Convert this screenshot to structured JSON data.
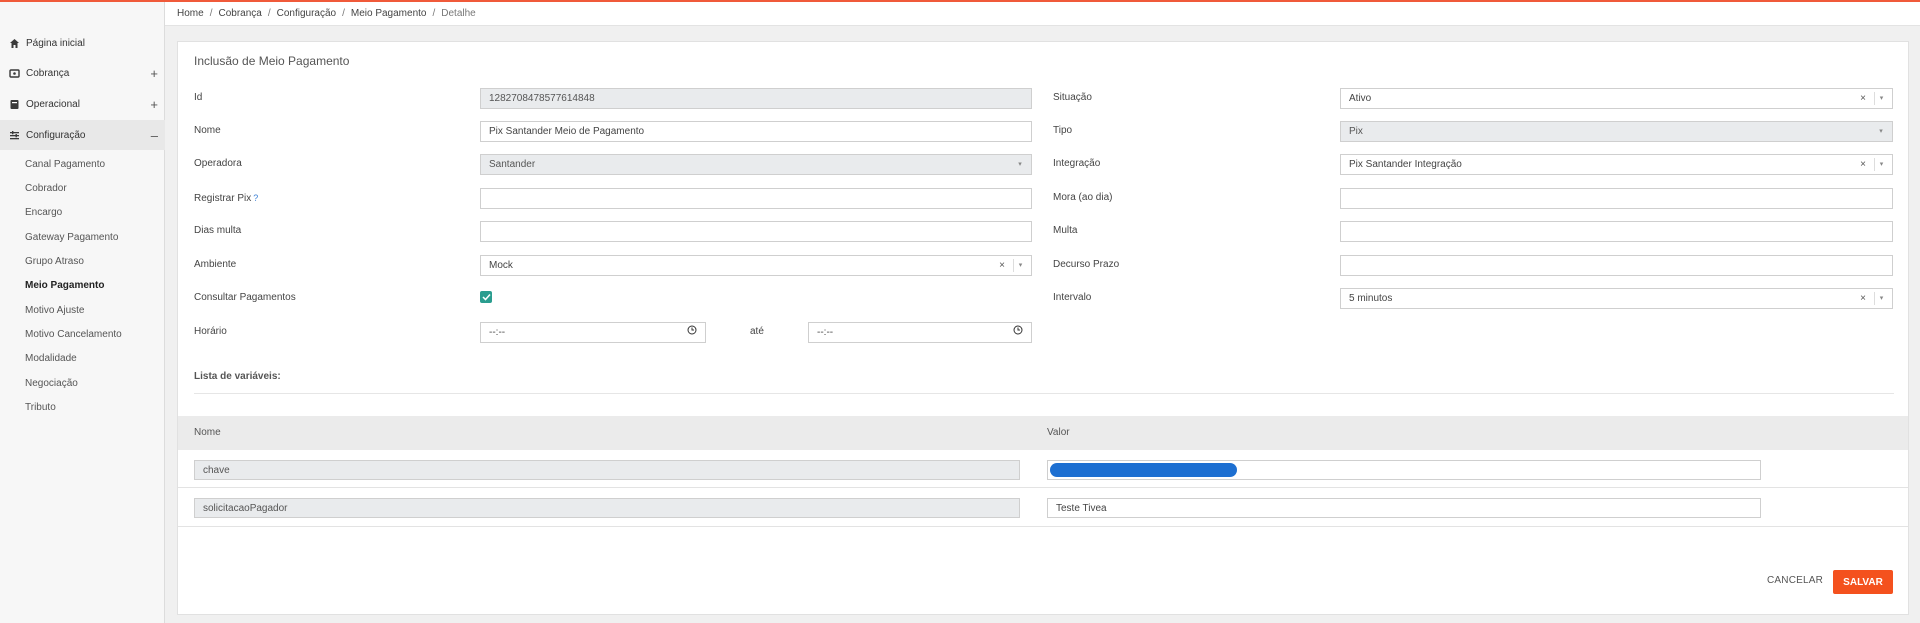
{
  "sidebar": {
    "main_items": [
      {
        "label": "Página inicial",
        "icon": "home-icon"
      },
      {
        "label": "Cobrança",
        "icon": "billing-icon",
        "toggle": "+"
      },
      {
        "label": "Operacional",
        "icon": "operational-icon",
        "toggle": "+"
      },
      {
        "label": "Configuração",
        "icon": "settings-list-icon",
        "toggle": "–"
      }
    ],
    "sub_items": [
      "Canal Pagamento",
      "Cobrador",
      "Encargo",
      "Gateway Pagamento",
      "Grupo Atraso",
      "Meio Pagamento",
      "Motivo Ajuste",
      "Motivo Cancelamento",
      "Modalidade",
      "Negociação",
      "Tributo"
    ]
  },
  "breadcrumb": [
    "Home",
    "Cobrança",
    "Configuração",
    "Meio Pagamento",
    "Detalhe"
  ],
  "form": {
    "title": "Inclusão de Meio Pagamento",
    "id_label": "Id",
    "id_value": "1282708478577614848",
    "nome_label": "Nome",
    "nome_value": "Pix Santander Meio de Pagamento",
    "operadora_label": "Operadora",
    "operadora_value": "Santander",
    "registrar_label": "Registrar Pix",
    "registrar_help": "?",
    "dias_multa_label": "Dias multa",
    "ambiente_label": "Ambiente",
    "ambiente_value": "Mock",
    "consultar_label": "Consultar Pagamentos",
    "horario_label": "Horário",
    "horario_from": "--:--",
    "ate_label": "até",
    "horario_to": "--:--",
    "situacao_label": "Situação",
    "situacao_value": "Ativo",
    "tipo_label": "Tipo",
    "tipo_value": "Pix",
    "integracao_label": "Integração",
    "integracao_value": "Pix Santander Integração",
    "mora_label": "Mora (ao dia)",
    "multa_label": "Multa",
    "decurso_label": "Decurso Prazo",
    "intervalo_label": "Intervalo",
    "intervalo_value": "5 minutos",
    "clear_symbol": "×",
    "caret_symbol": "▾"
  },
  "variables": {
    "title": "Lista de variáveis:",
    "col_nome": "Nome",
    "col_valor": "Valor",
    "rows": [
      {
        "nome": "chave",
        "valor": ""
      },
      {
        "nome": "solicitacaoPagador",
        "valor": "Teste Tivea"
      }
    ]
  },
  "actions": {
    "cancel": "CANCELAR",
    "save": "SALVAR"
  },
  "colors": {
    "accent": "#f4511e",
    "check": "#2a9d8f",
    "topline": "#f05a3a"
  }
}
